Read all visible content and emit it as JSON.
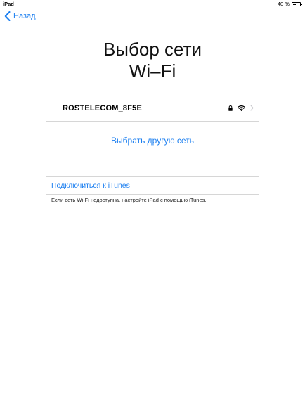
{
  "status_bar": {
    "device": "iPad",
    "battery": "40 %",
    "battery_level": 0.4
  },
  "nav": {
    "back_label": "Назад"
  },
  "page": {
    "title_line1": "Выбор сети",
    "title_line2": "Wi–Fi"
  },
  "networks": [
    {
      "name": "ROSTELECOM_8F5E",
      "secured": true,
      "icons": [
        "lock-icon",
        "wifi-icon",
        "chevron-right-icon"
      ]
    }
  ],
  "other_network_label": "Выбрать другую сеть",
  "itunes": {
    "link_label": "Подключиться к iTunes",
    "note": "Если сеть Wi-Fi недоступна, настройте iPad с помощью iTunes."
  },
  "colors": {
    "accent": "#1a7ef0",
    "separator": "#d6d6d6"
  }
}
